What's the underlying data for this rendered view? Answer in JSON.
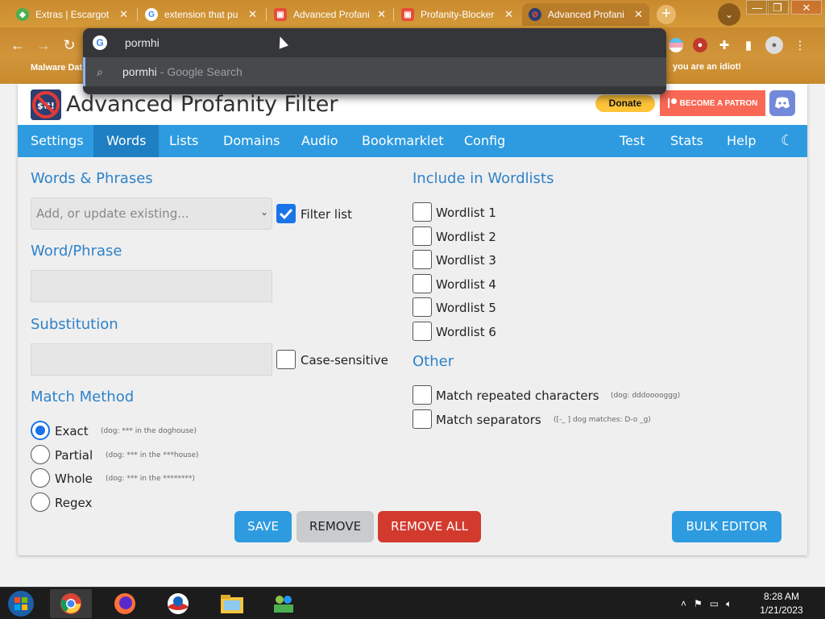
{
  "browser": {
    "tabs": [
      {
        "title": "Extras | Escargot",
        "icon": "chrome-web-store-icon"
      },
      {
        "title": "extension that pu",
        "icon": "google-icon"
      },
      {
        "title": "Advanced Profani",
        "icon": "extension-icon"
      },
      {
        "title": "Profanity-Blocker",
        "icon": "extension-icon"
      },
      {
        "title": "Advanced Profani",
        "icon": "apf-icon",
        "active": true
      }
    ],
    "omnibox": {
      "input": "pormhi",
      "suggestion": "pormhi",
      "suggestion_sub": "- Google Search"
    },
    "bookmarks": {
      "left": "Malware Dat",
      "right": "you are an idiot!"
    }
  },
  "app": {
    "title": "Advanced Profanity Filter",
    "donate_label": "Donate",
    "patron_label": "BECOME A PATRON",
    "nav": [
      {
        "label": "Settings"
      },
      {
        "label": "Words",
        "active": true
      },
      {
        "label": "Lists"
      },
      {
        "label": "Domains"
      },
      {
        "label": "Audio"
      },
      {
        "label": "Bookmarklet"
      },
      {
        "label": "Config"
      },
      {
        "label": "Test"
      },
      {
        "label": "Stats"
      },
      {
        "label": "Help"
      }
    ]
  },
  "words": {
    "section_title": "Words & Phrases",
    "select_placeholder": "Add, or update existing...",
    "filter_list_label": "Filter list",
    "word_label": "Word/Phrase",
    "substitution_label": "Substitution",
    "case_sensitive_label": "Case-sensitive",
    "match_method_title": "Match Method",
    "match_methods": [
      {
        "label": "Exact",
        "hint": "(dog: *** in the doghouse)",
        "selected": true
      },
      {
        "label": "Partial",
        "hint": "(dog: *** in the ***house)"
      },
      {
        "label": "Whole",
        "hint": "(dog: *** in the ********)"
      },
      {
        "label": "Regex",
        "hint": ""
      }
    ]
  },
  "wordlists": {
    "title": "Include in Wordlists",
    "items": [
      "Wordlist 1",
      "Wordlist 2",
      "Wordlist 3",
      "Wordlist 4",
      "Wordlist 5",
      "Wordlist 6"
    ]
  },
  "other": {
    "title": "Other",
    "repeated_label": "Match repeated characters",
    "repeated_hint": "(dog: dddooooggg)",
    "separators_label": "Match separators",
    "separators_hint": "([-_ ] dog matches: D-o _g)"
  },
  "buttons": {
    "save": "SAVE",
    "remove": "REMOVE",
    "remove_all": "REMOVE ALL",
    "bulk": "BULK EDITOR"
  },
  "taskbar": {
    "time": "8:28 AM",
    "date": "1/21/2023"
  },
  "colors": {
    "accent": "#2e9be0",
    "nav_active": "#1e7fc3",
    "save": "#2e9be0",
    "remove_all": "#d33a2e",
    "donate": "#ffc439",
    "patron": "#f96854",
    "discord": "#7289da"
  }
}
